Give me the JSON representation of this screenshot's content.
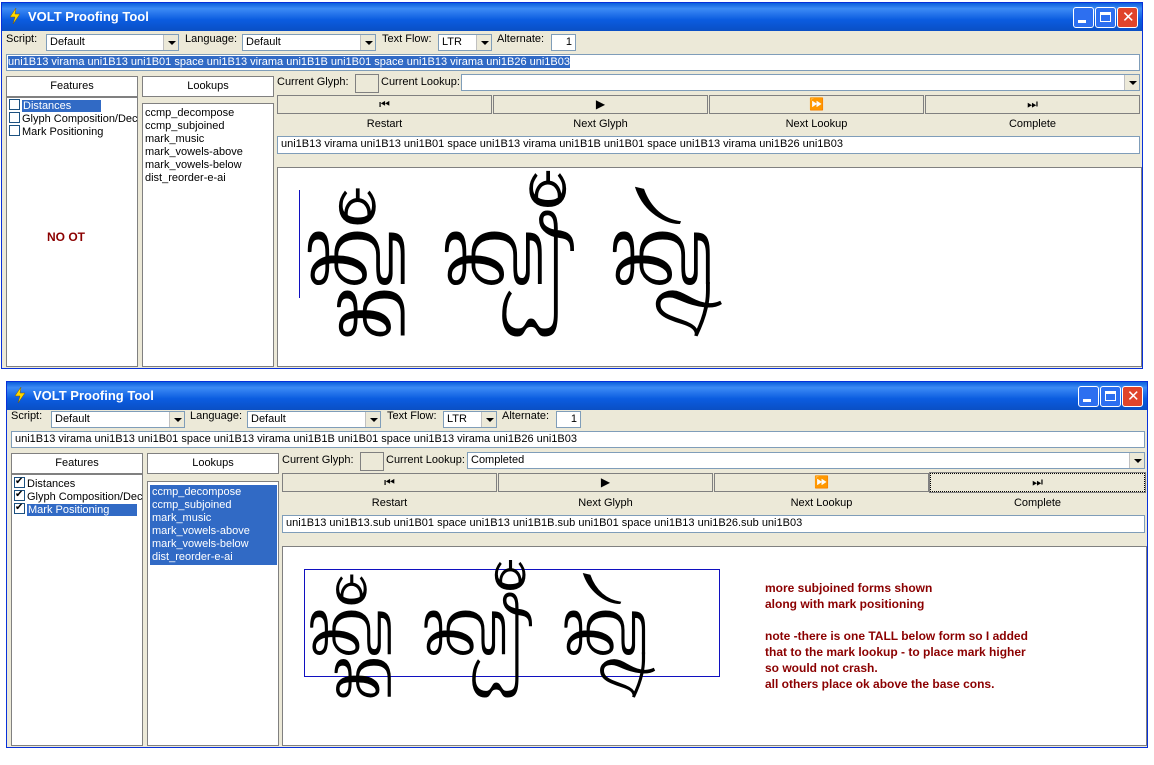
{
  "window1": {
    "title": "VOLT Proofing Tool",
    "script_label": "Script:",
    "script_value": "Default",
    "language_label": "Language:",
    "language_value": "Default",
    "textflow_label": "Text Flow:",
    "textflow_value": "LTR",
    "alternate_label": "Alternate:",
    "alternate_value": "1",
    "input_text": "uni1B13 virama uni1B13 uni1B01 space uni1B13 virama uni1B1B uni1B01 space uni1B13 virama uni1B26 uni1B03",
    "features_header": "Features",
    "lookups_header": "Lookups",
    "features": [
      {
        "label": "Distances",
        "checked": false,
        "selected": true
      },
      {
        "label": "Glyph Composition/Dec",
        "checked": false,
        "selected": false
      },
      {
        "label": "Mark Positioning",
        "checked": false,
        "selected": false
      }
    ],
    "lookups": [
      "ccmp_decompose",
      "ccmp_subjoined",
      "mark_music",
      "mark_vowels-above",
      "mark_vowels-below",
      "dist_reorder-e-ai"
    ],
    "lookups_selected": false,
    "no_ot_note": "NO OT",
    "current_glyph_label": "Current Glyph:",
    "current_lookup_label": "Current Lookup:",
    "current_lookup_value": "",
    "nav_icons": [
      "⏮",
      "▶",
      "⏩",
      "⏭"
    ],
    "nav_labels": [
      "Restart",
      "Next Glyph",
      "Next Lookup",
      "Complete"
    ],
    "glyph_string": "uni1B13 virama uni1B13 uni1B01 space uni1B13 virama uni1B1B uni1B01 space uni1B13 virama uni1B26 uni1B03",
    "rendered_text": "ᬓ᭄ᬓᬁ ᬓ᭄ᬛᬁ ᬓ᭄ᬦᬃ"
  },
  "window2": {
    "title": "VOLT Proofing Tool",
    "script_label": "Script:",
    "script_value": "Default",
    "language_label": "Language:",
    "language_value": "Default",
    "textflow_label": "Text Flow:",
    "textflow_value": "LTR",
    "alternate_label": "Alternate:",
    "alternate_value": "1",
    "input_text": "uni1B13 virama uni1B13 uni1B01 space uni1B13 virama uni1B1B uni1B01 space uni1B13 virama uni1B26 uni1B03",
    "features_header": "Features",
    "lookups_header": "Lookups",
    "features": [
      {
        "label": "Distances",
        "checked": true,
        "selected": false
      },
      {
        "label": "Glyph Composition/Dec",
        "checked": true,
        "selected": false
      },
      {
        "label": "Mark Positioning",
        "checked": true,
        "selected": true
      }
    ],
    "lookups": [
      "ccmp_decompose",
      "ccmp_subjoined",
      "mark_music",
      "mark_vowels-above",
      "mark_vowels-below",
      "dist_reorder-e-ai"
    ],
    "lookups_selected": true,
    "current_glyph_label": "Current Glyph:",
    "current_lookup_label": "Current Lookup:",
    "current_lookup_value": "Completed",
    "nav_icons": [
      "⏮",
      "▶",
      "⏩",
      "⏭"
    ],
    "nav_labels": [
      "Restart",
      "Next Glyph",
      "Next Lookup",
      "Complete"
    ],
    "glyph_string": "uni1B13 uni1B13.sub uni1B01 space uni1B13 uni1B1B.sub uni1B01 space uni1B13 uni1B26.sub uni1B03",
    "rendered_text": "ᬓ᭄ᬓᬁ ᬓ᭄ᬛᬁ ᬓ᭄ᬦᬃ",
    "note": "more subjoined forms shown\nalong with mark positioning\n\nnote -there is one TALL below form so I added\nthat to the mark lookup - to place mark higher\nso would not crash.\nall others place ok above the base cons."
  }
}
